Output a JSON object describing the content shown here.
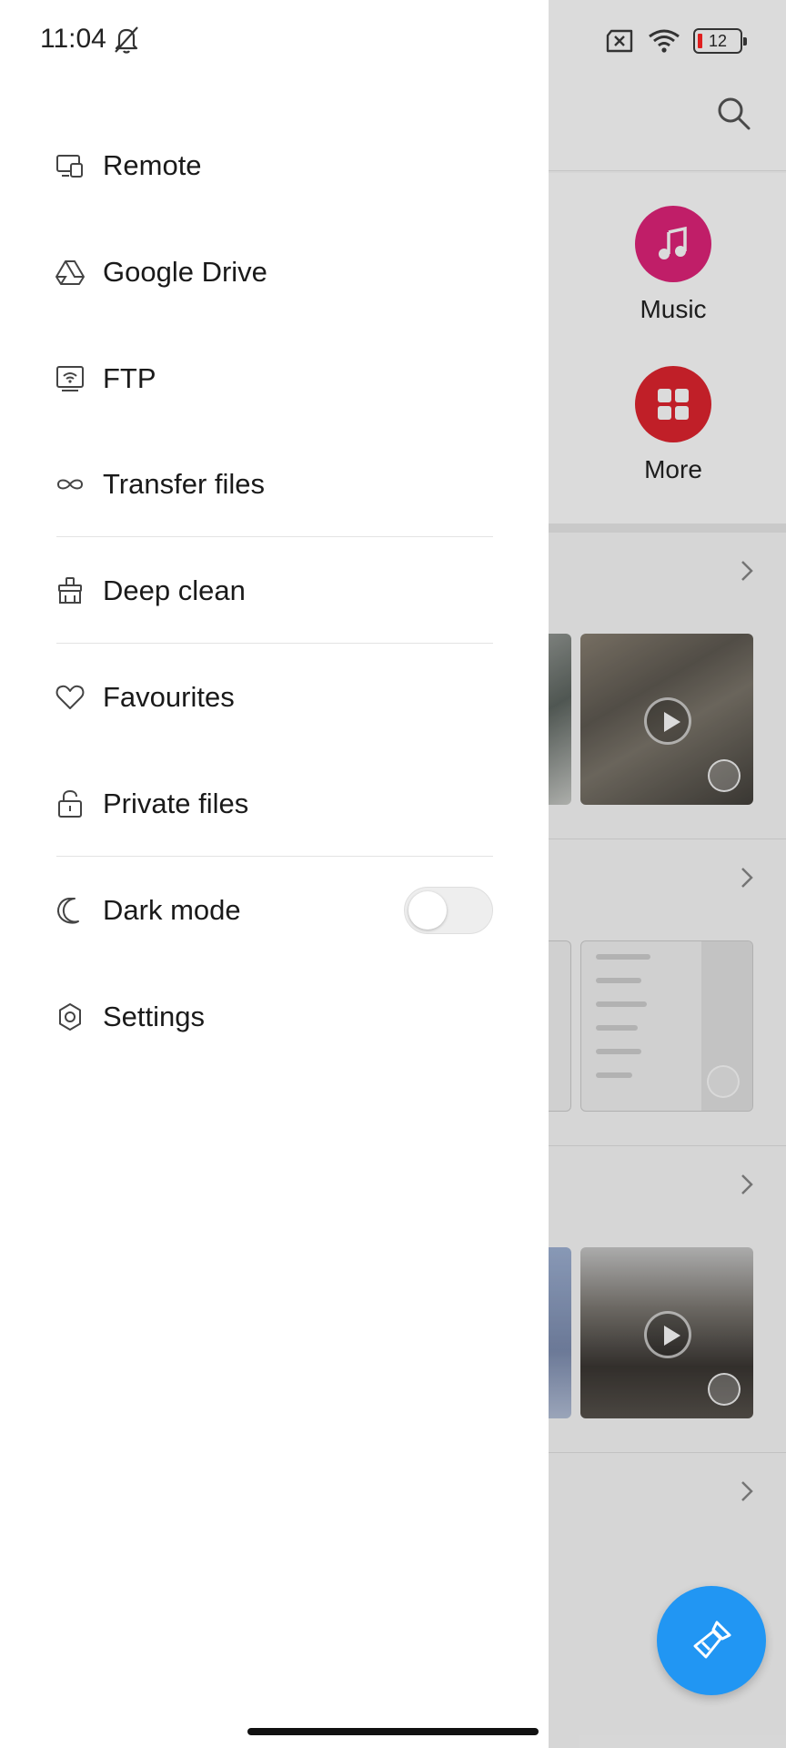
{
  "status_bar": {
    "time": "11:04",
    "battery_level": "12"
  },
  "drawer": {
    "items": [
      {
        "label": "Remote",
        "icon": "remote-device-icon"
      },
      {
        "label": "Google Drive",
        "icon": "google-drive-icon"
      },
      {
        "label": "FTP",
        "icon": "ftp-icon"
      },
      {
        "label": "Transfer files",
        "icon": "infinity-icon"
      },
      {
        "label": "Deep clean",
        "icon": "brush-icon"
      },
      {
        "label": "Favourites",
        "icon": "heart-icon"
      },
      {
        "label": "Private files",
        "icon": "lock-icon"
      },
      {
        "label": "Dark mode",
        "icon": "moon-icon",
        "toggle": false
      },
      {
        "label": "Settings",
        "icon": "gear-icon"
      }
    ]
  },
  "background": {
    "categories": [
      {
        "label": "Music",
        "icon": "music-note-icon",
        "color": "#e0247a"
      },
      {
        "label": "More",
        "icon": "grid-icon",
        "color": "#e0252f"
      }
    ],
    "fab_icon": "cleaner-brush-icon",
    "fab_color": "#2196f3"
  }
}
